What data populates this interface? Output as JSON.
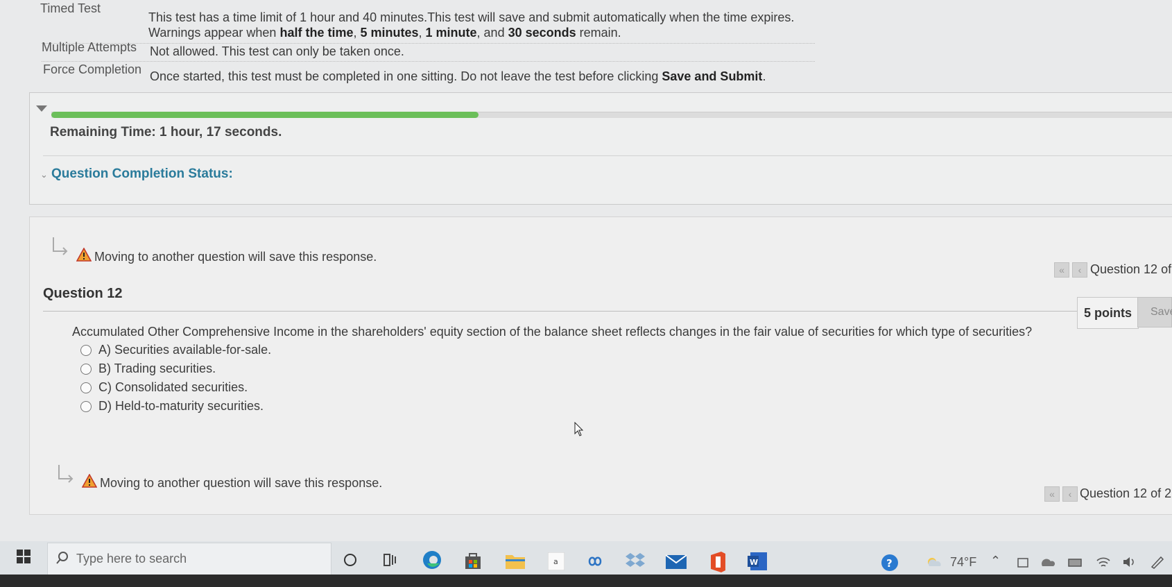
{
  "info": {
    "timed": {
      "label": "Timed Test",
      "line1": "This test has a time limit of 1 hour and 40 minutes.This test will save and submit automatically when the time expires.",
      "line2_prefix": "Warnings appear when ",
      "bold1": "half the time",
      "sep1": ", ",
      "bold2": "5 minutes",
      "sep2": ", ",
      "bold3": "1 minute",
      "sep3": ", and ",
      "bold4": "30 seconds",
      "line2_suffix": " remain."
    },
    "multiple": {
      "label": "Multiple Attempts",
      "text": "Not allowed. This test can only be taken once."
    },
    "force": {
      "label": "Force Completion",
      "text_prefix": "Once started, this test must be completed in one sitting. Do not leave the test before clicking ",
      "bold": "Save and Submit",
      "text_suffix": "."
    }
  },
  "timer": {
    "progress_fraction": 0.38,
    "remaining": "Remaining Time: 1 hour, 17 seconds."
  },
  "completion_status": "Question Completion Status:",
  "warning": "Moving to another question will save this response.",
  "nav": {
    "top_label": "Question 12 of",
    "bottom_label": "Question 12 of 2"
  },
  "question": {
    "title": "Question 12",
    "points": "5 points",
    "save": "Save",
    "text": "Accumulated Other Comprehensive Income in the shareholders' equity section of the balance sheet reflects changes in the fair value of securities for which type of securities?",
    "options": [
      "A) Securities available-for-sale.",
      "B) Trading securities.",
      "C) Consolidated securities.",
      "D) Held-to-maturity securities."
    ]
  },
  "taskbar": {
    "search_placeholder": "Type here to search",
    "weather": "74°F",
    "icons": [
      "windows-start-icon",
      "cortana-icon",
      "task-view-icon",
      "edge-icon",
      "store-icon",
      "file-explorer-icon",
      "amazon-icon",
      "infinity-icon",
      "dropbox-icon",
      "mail-icon",
      "office-icon",
      "word-icon",
      "help-icon"
    ]
  }
}
